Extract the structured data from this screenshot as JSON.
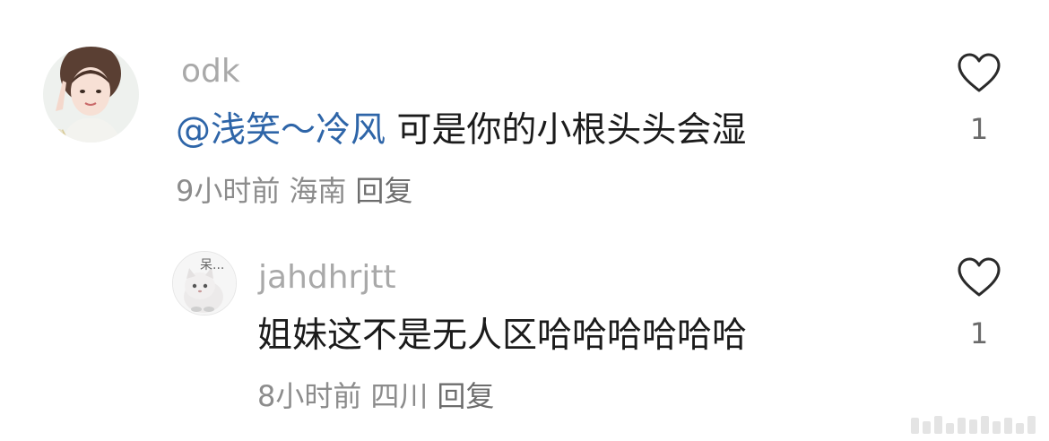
{
  "comments": [
    {
      "username": "odk",
      "mention": "@浅笑～冷风",
      "text": " 可是你的小根头头会湿",
      "time": "9小时前",
      "location": "海南",
      "reply_label": "回复",
      "likes": "1"
    },
    {
      "username": "jahdhrjtt",
      "avatar_text": "呆...",
      "text": "姐妹这不是无人区哈哈哈哈哈哈",
      "time": "8小时前",
      "location": "四川",
      "reply_label": "回复",
      "likes": "1"
    }
  ],
  "colors": {
    "username": "#a9a9a9",
    "mention": "#2e65a8",
    "body_text": "#1b1b1b",
    "meta": "#8c8c8c"
  },
  "icons": {
    "like": "heart-outline-icon"
  }
}
